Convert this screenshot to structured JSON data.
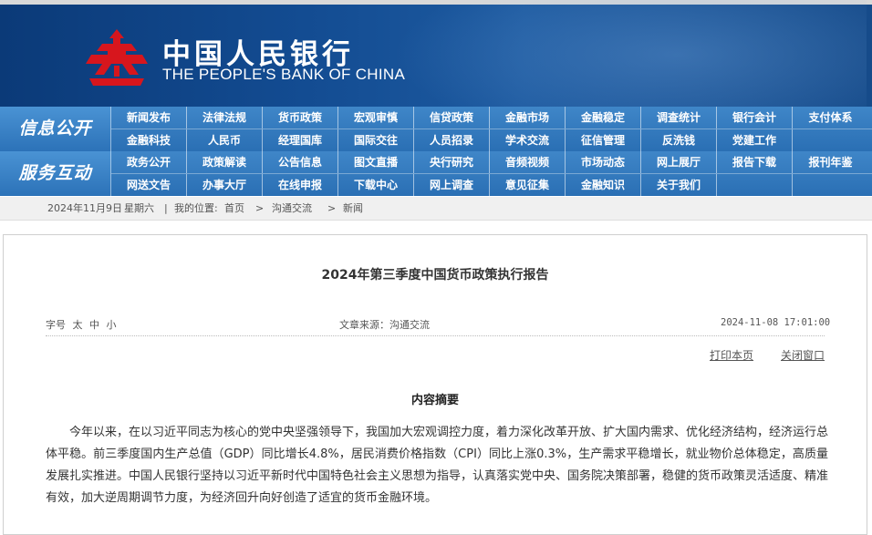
{
  "banner": {
    "title_cn": "中国人民银行",
    "title_en": "THE PEOPLE'S BANK OF CHINA",
    "logo_icon": "pboc-emblem-icon",
    "bg_color": "#134c92",
    "logo_color": "#d7161d"
  },
  "nav": {
    "sections": [
      {
        "title": "信息公开",
        "row1": [
          "新闻发布",
          "法律法规",
          "货币政策",
          "宏观审慎",
          "信贷政策",
          "金融市场",
          "金融稳定",
          "调查统计",
          "银行会计",
          "支付体系"
        ],
        "row2": [
          "金融科技",
          "人民币",
          "经理国库",
          "国际交往",
          "人员招录",
          "学术交流",
          "征信管理",
          "反洗钱",
          "党建工作",
          ""
        ]
      },
      {
        "title": "服务互动",
        "row1": [
          "政务公开",
          "政策解读",
          "公告信息",
          "图文直播",
          "央行研究",
          "音频视频",
          "市场动态",
          "网上展厅",
          "报告下载",
          "报刊年鉴"
        ],
        "row2": [
          "网送文告",
          "办事大厅",
          "在线申报",
          "下载中心",
          "网上调查",
          "意见征集",
          "金融知识",
          "关于我们",
          "",
          ""
        ]
      }
    ],
    "accent_color": "#2a6fb4"
  },
  "breadcrumb": {
    "date": "2024年11月9日",
    "weekday": "星期六",
    "sep": "|",
    "location_label": "我的位置:",
    "home": "首页",
    "arrow": ">",
    "level1": "沟通交流",
    "level2": "新闻"
  },
  "article": {
    "title": "2024年第三季度中国货币政策执行报告",
    "font_label": "字号",
    "font_large": "太",
    "font_medium": "中",
    "font_small": "小",
    "source": "文章来源：沟通交流",
    "datetime": "2024-11-08 17:01:00",
    "print": "打印本页",
    "close": "关闭窗口",
    "section_heading": "内容摘要",
    "paragraph": "今年以来，在以习近平同志为核心的党中央坚强领导下，我国加大宏观调控力度，着力深化改革开放、扩大国内需求、优化经济结构，经济运行总体平稳。前三季度国内生产总值（GDP）同比增长4.8%，居民消费价格指数（CPI）同比上涨0.3%，生产需求平稳增长，就业物价总体稳定，高质量发展扎实推进。中国人民银行坚持以习近平新时代中国特色社会主义思想为指导，认真落实党中央、国务院决策部署，稳健的货币政策灵活适度、精准有效，加大逆周期调节力度，为经济回升向好创造了适宜的货币金融环境。"
  }
}
